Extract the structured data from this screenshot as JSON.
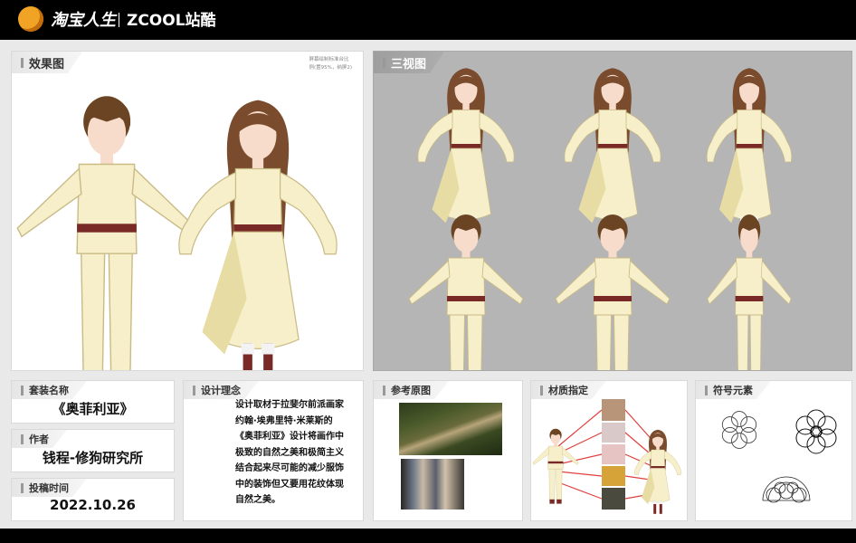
{
  "header": {
    "brand_taobao": "淘宝人生",
    "brand_zcool": "ZCOOL站酷"
  },
  "effect_panel": {
    "label": "效果图",
    "note_line1": "屏幕绘制标准台比",
    "note_line2": "例(置95%，纳屏2)"
  },
  "three_view_panel": {
    "label": "三视图"
  },
  "set_name": {
    "label": "套装名称",
    "value": "《奥菲利亚》"
  },
  "author": {
    "label": "作者",
    "value": "钱程-修狗研究所"
  },
  "submit_time": {
    "label": "投稿时间",
    "value": "2022.10.26"
  },
  "design_concept": {
    "label": "设计理念",
    "lines": [
      "设计取材于拉斐尔前派画家",
      "约翰·埃弗里特·米莱斯的",
      "《奥菲利亚》设计将画作中",
      "极致的自然之美和极简主义",
      "结合起来尽可能的减少服饰",
      "中的装饰但又要用花纹体现",
      "自然之美。"
    ]
  },
  "reference": {
    "label": "参考原图"
  },
  "material": {
    "label": "材质指定"
  },
  "symbols": {
    "label": "符号元素"
  },
  "colors": {
    "dress": "#f6efc9",
    "dress_shade": "#e7dca4",
    "belt": "#7a2a26",
    "hair_boy": "#6b4423",
    "hair_girl": "#7a4b2c",
    "skin": "#f7dccb",
    "line_red": "#e0403e"
  }
}
